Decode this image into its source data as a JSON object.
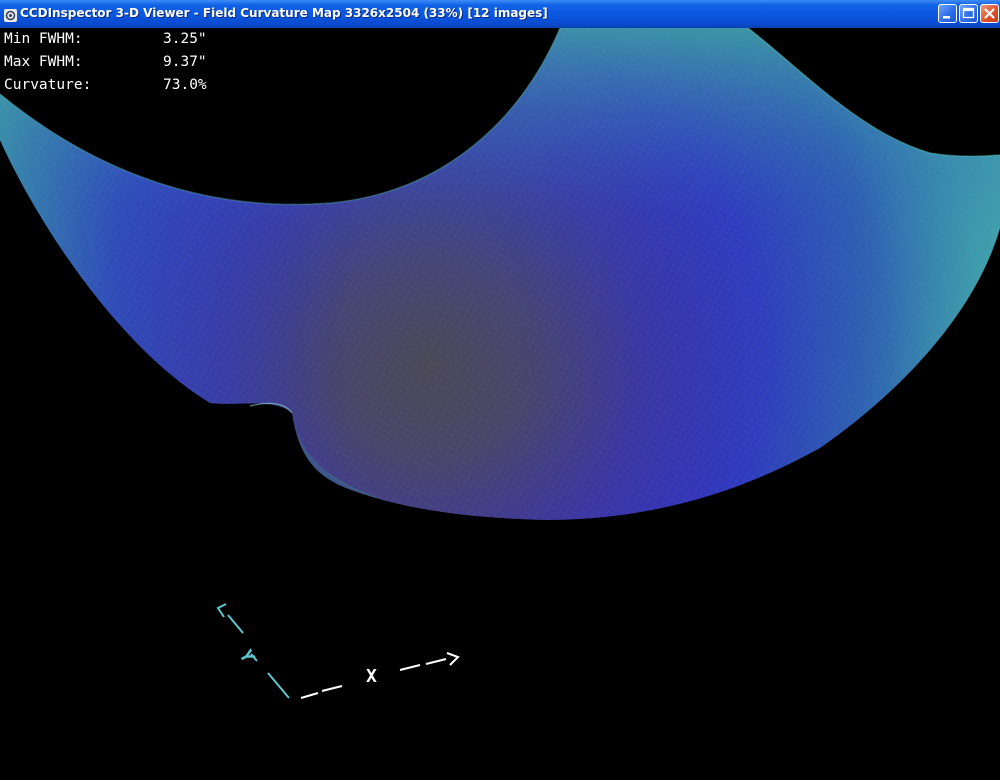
{
  "window": {
    "title": "CCDInspector 3-D Viewer - Field Curvature Map 3326x2504 (33%)  [12 images]"
  },
  "stats": [
    {
      "label": "Min FWHM:",
      "value": "3.25\""
    },
    {
      "label": "Max FWHM:",
      "value": "9.37\""
    },
    {
      "label": "Curvature:",
      "value": "73.0%"
    }
  ],
  "axes": {
    "x_label": "X",
    "y_label": "Y"
  },
  "colors": {
    "background": "#000000",
    "surface_blue": "#2a2fb8",
    "surface_teal": "#3aa7a0",
    "surface_center": "#4a4a55",
    "axis_y_color": "#5cc8d0",
    "axis_x_color": "#ffffff",
    "titlebar": "#0a54dc"
  },
  "icons": [
    "app-icon",
    "minimize-icon",
    "maximize-icon",
    "close-icon"
  ]
}
